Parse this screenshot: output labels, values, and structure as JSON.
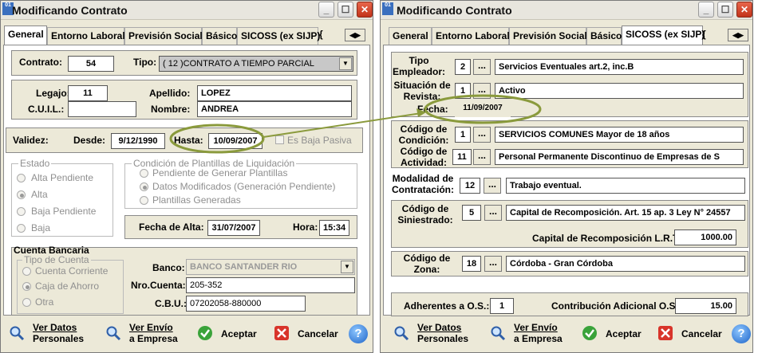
{
  "left": {
    "title": "Modificando Contrato",
    "icon_text": "01",
    "tabs": [
      "General",
      "Entorno Laboral",
      "Previsión Social",
      "Básico",
      "SICOSS (ex SIJP)",
      "{"
    ],
    "contrato": {
      "label": "Contrato:",
      "value": "54"
    },
    "tipo": {
      "label": "Tipo:",
      "value": "( 12 )CONTRATO A TIEMPO PARCIAL"
    },
    "legajo": {
      "label": "Legajo:",
      "value": "11"
    },
    "apellido": {
      "label": "Apellido:",
      "value": "LOPEZ"
    },
    "cuil": {
      "label": "C.U.I.L.:",
      "value": ""
    },
    "nombre": {
      "label": "Nombre:",
      "value": "ANDREA"
    },
    "validez": {
      "label": "Validez:",
      "desde_label": "Desde:",
      "desde": "9/12/1990",
      "hasta_label": "Hasta:",
      "hasta": "10/09/2007",
      "baja_label": "Es Baja Pasiva"
    },
    "estado": {
      "title": "Estado",
      "options": [
        "Alta Pendiente",
        "Alta",
        "Baja Pendiente",
        "Baja"
      ]
    },
    "plantillas": {
      "title": "Condición de Plantillas de Liquidación",
      "options": [
        "Pendiente de Generar Plantillas",
        "Datos Modificados (Generación Pendiente)",
        "Plantillas Generadas"
      ]
    },
    "fecha_alta": {
      "label": "Fecha de Alta:",
      "value": "31/07/2007"
    },
    "hora": {
      "label": "Hora:",
      "value": "15:34"
    },
    "cuenta": {
      "title": "Cuenta Bancaria",
      "tipo_title": "Tipo de Cuenta",
      "options": [
        "Cuenta Corriente",
        "Caja de Ahorro",
        "Otra"
      ]
    },
    "banco": {
      "label": "Banco:",
      "value": "BANCO SANTANDER RIO"
    },
    "nro_cuenta": {
      "label": "Nro.Cuenta:",
      "value": "205-352"
    },
    "cbu": {
      "label": "C.B.U.:",
      "value": "07202058-880000"
    },
    "buttons": {
      "ver_datos_1": "Ver Datos",
      "ver_datos_2": "Personales",
      "ver_envio_1": "Ver Envío",
      "ver_envio_2": "a Empresa",
      "aceptar": "Aceptar",
      "cancelar": "Cancelar",
      "help": "?"
    }
  },
  "right": {
    "title": "Modificando Contrato",
    "icon_text": "01",
    "tabs": [
      "General",
      "Entorno Laboral",
      "Previsión Social",
      "Básico",
      "SICOSS (ex SIJP)",
      "{"
    ],
    "tipo_empleador": {
      "label1": "Tipo",
      "label2": "Empleador:",
      "code": "2",
      "value": "Servicios Eventuales art.2, inc.B"
    },
    "situacion": {
      "label1": "Situación de",
      "label2": "Revista:",
      "code": "1",
      "value": "Activo"
    },
    "fecha": {
      "label": "Fecha:",
      "value": "11/09/2007"
    },
    "condicion": {
      "label1": "Código de",
      "label2": "Condición:",
      "code": "1",
      "value": "SERVICIOS COMUNES Mayor de 18 años"
    },
    "actividad": {
      "label1": "Código de",
      "label2": "Actividad:",
      "code": "11",
      "value": "Personal Permanente Discontinuo de Empresas de S"
    },
    "modalidad": {
      "label1": "Modalidad de",
      "label2": "Contratación:",
      "code": "12",
      "value": "Trabajo eventual."
    },
    "siniestrado": {
      "label1": "Código de",
      "label2": "Siniestrado:",
      "code": "5",
      "value": "Capital de Recomposición. Art. 15 ap. 3 Ley N° 24557"
    },
    "capital": {
      "label": "Capital de Recomposición L.R.T.:",
      "value": "1000.00"
    },
    "zona": {
      "label1": "Código de",
      "label2": "Zona:",
      "code": "18",
      "value": "Córdoba - Gran Córdoba"
    },
    "adherentes": {
      "label": "Adherentes a O.S.:",
      "value": "1"
    },
    "contribucion": {
      "label": "Contribución Adicional O.S.:",
      "value": "15.00"
    },
    "buttons": {
      "ver_datos_1": "Ver Datos",
      "ver_datos_2": "Personales",
      "ver_envio_1": "Ver Envío",
      "ver_envio_2": "a Empresa",
      "aceptar": "Aceptar",
      "cancelar": "Cancelar",
      "help": "?"
    }
  },
  "colors": {
    "window_bg": "#ECE9D8",
    "annotation": "#8a9a3c",
    "close_btn": "#d0452a"
  },
  "dots_label": "..."
}
